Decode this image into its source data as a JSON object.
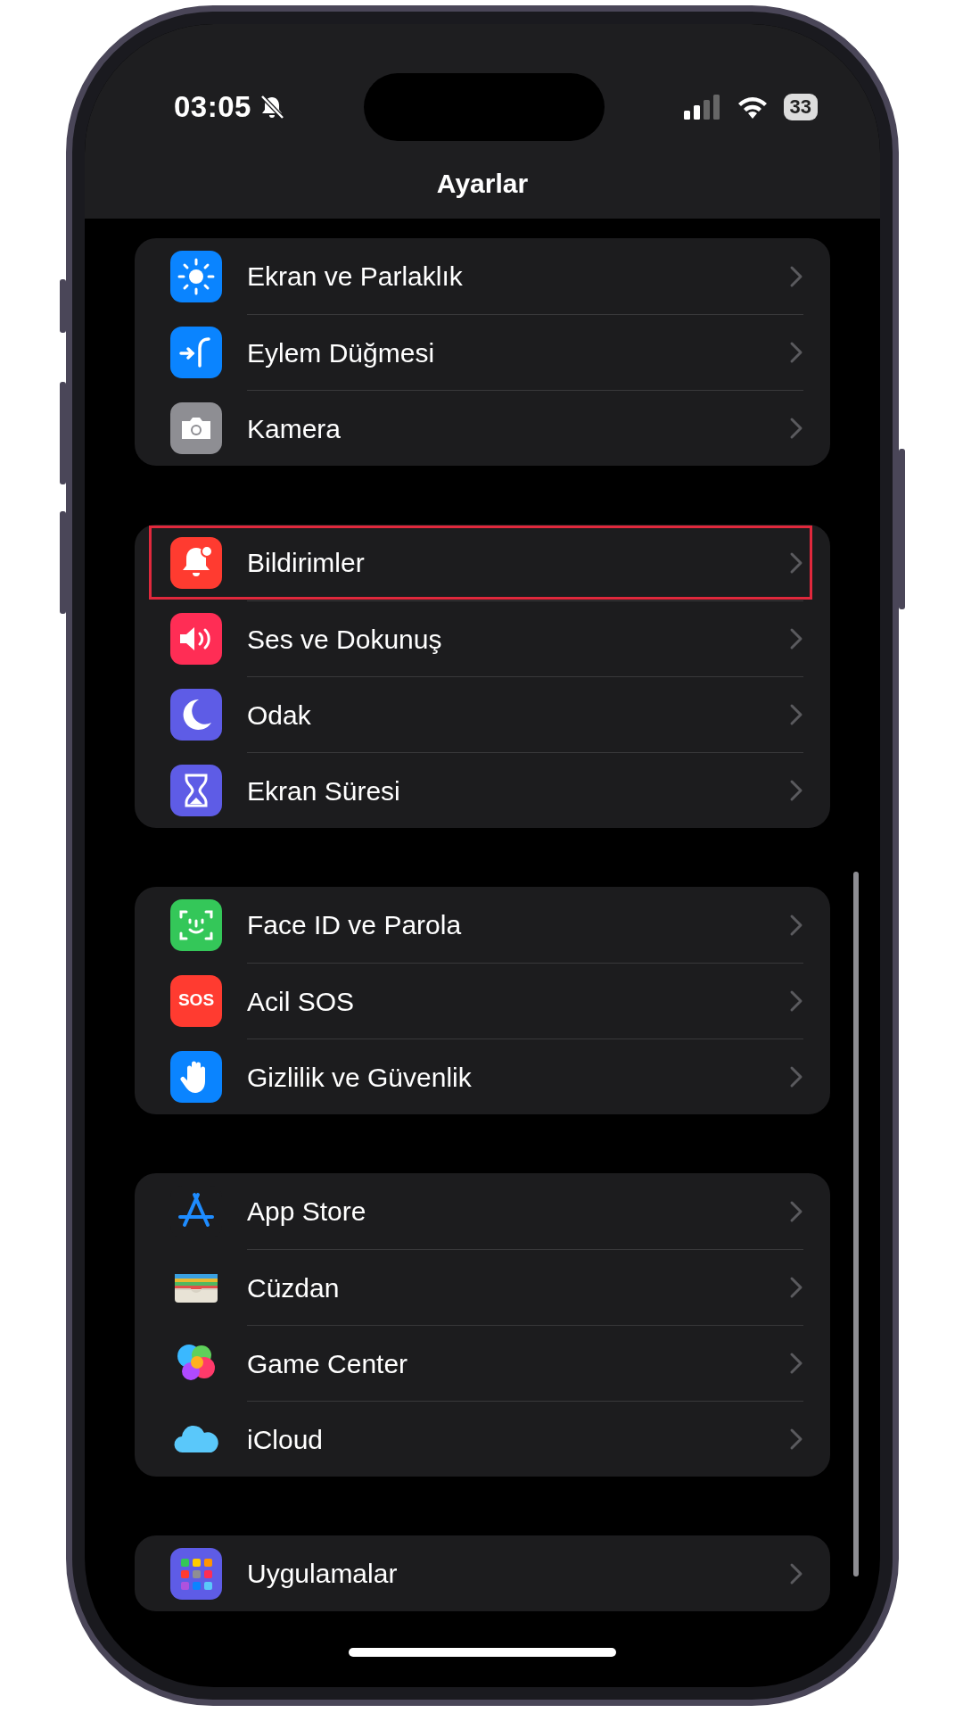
{
  "status_bar": {
    "time": "03:05",
    "battery": "33"
  },
  "nav_title": "Ayarlar",
  "groups": [
    {
      "items": [
        {
          "kind": "display",
          "label": "Ekran ve Parlaklık",
          "highlighted": false
        },
        {
          "kind": "action",
          "label": "Eylem Düğmesi",
          "highlighted": false
        },
        {
          "kind": "camera",
          "label": "Kamera",
          "highlighted": false
        }
      ]
    },
    {
      "items": [
        {
          "kind": "notifications",
          "label": "Bildirimler",
          "highlighted": true
        },
        {
          "kind": "sound",
          "label": "Ses ve Dokunuş",
          "highlighted": false
        },
        {
          "kind": "focus",
          "label": "Odak",
          "highlighted": false
        },
        {
          "kind": "screentime",
          "label": "Ekran Süresi",
          "highlighted": false
        }
      ]
    },
    {
      "items": [
        {
          "kind": "faceid",
          "label": "Face ID ve Parola",
          "highlighted": false
        },
        {
          "kind": "sos",
          "label": "Acil SOS",
          "icon_text": "SOS",
          "highlighted": false
        },
        {
          "kind": "privacy",
          "label": "Gizlilik ve Güvenlik",
          "highlighted": false
        }
      ]
    },
    {
      "items": [
        {
          "kind": "appstore",
          "label": "App Store",
          "highlighted": false
        },
        {
          "kind": "wallet",
          "label": "Cüzdan",
          "highlighted": false
        },
        {
          "kind": "gamecenter",
          "label": "Game Center",
          "highlighted": false
        },
        {
          "kind": "icloud",
          "label": "iCloud",
          "highlighted": false
        }
      ]
    },
    {
      "items": [
        {
          "kind": "apps",
          "label": "Uygulamalar",
          "highlighted": false
        }
      ]
    }
  ]
}
